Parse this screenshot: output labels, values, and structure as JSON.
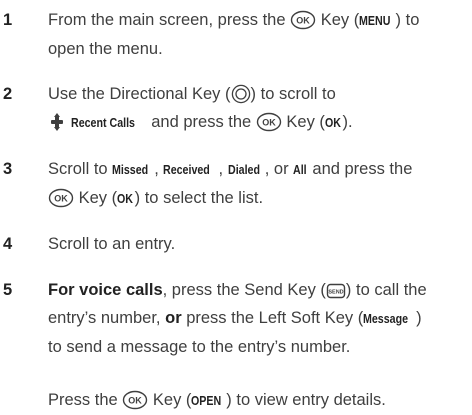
{
  "steps": [
    {
      "number": "1",
      "from_main": "From the main screen, press the",
      "key": "Key",
      "menu_label": "MENU",
      "to_open": "to",
      "line2": "open the menu."
    },
    {
      "number": "2",
      "use_dir": "Use the Directional Key",
      "scroll_to": "to scroll to",
      "recent_calls": "Recent Calls",
      "and_press": "and press the",
      "key": "Key",
      "ok_label": "OK",
      "end": "."
    },
    {
      "number": "3",
      "scroll_to": "Scroll to",
      "missed": "Missed",
      "received": "Received",
      "dialed": "Dialed",
      "or": "or",
      "all": "All",
      "and_press": "and press the",
      "key": "Key",
      "ok_label": "OK",
      "select": "to select the list."
    },
    {
      "number": "4",
      "text": "Scroll to an entry."
    },
    {
      "number": "5",
      "for_voice": "For voice calls",
      "press_send": ", press the Send Key",
      "to_call": "to call the",
      "entry_number": "entry’s number,",
      "or": "or",
      "press_left": "press the Left Soft Key",
      "message_label": "Message",
      "line3": "to send a message to the entry’s number."
    }
  ],
  "note": {
    "press_the": "Press the",
    "key": "Key",
    "open_label": "OPEN",
    "view_details": "to view entry details."
  },
  "icons": {
    "ok_key": "ok-key-icon",
    "directional_key": "directional-key-icon",
    "recent_calls_menu": "recent-calls-icon",
    "send_key": "send-key-icon"
  }
}
